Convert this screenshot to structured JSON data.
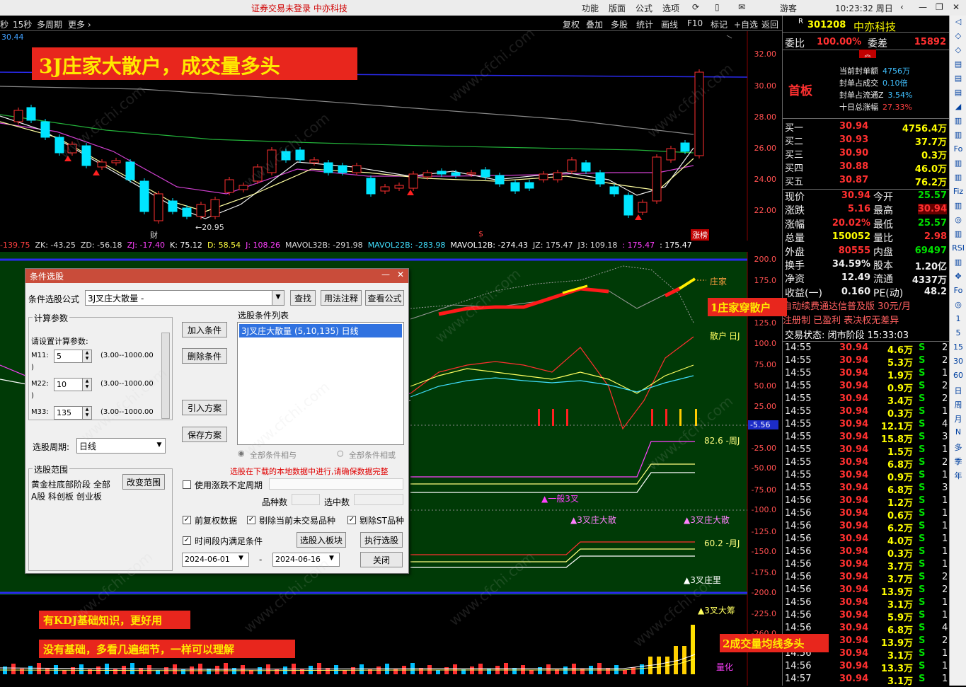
{
  "menubar": {
    "notice": "证券交易未登录 中亦科技",
    "items": [
      "功能",
      "版面",
      "公式",
      "选项"
    ],
    "guest": "游客",
    "clock": "10:23:32 周日"
  },
  "toolbar": {
    "left": [
      "秒",
      "15秒",
      "多周期",
      "更多 ›"
    ],
    "right": [
      "复权",
      "叠加",
      "多股",
      "统计",
      "画线",
      "F10",
      "标记",
      "+自选",
      "返回"
    ]
  },
  "chart": {
    "top_label": "30.44",
    "price_axis": [
      "32.00",
      "30.00",
      "28.00",
      "26.00",
      "24.00",
      "22.00"
    ],
    "low_label": "←20.95",
    "marks": [
      "财",
      "$",
      "涨榜"
    ],
    "banner_main": "3J庄家大散户，成交量多头",
    "mid_axis": [
      "200.0",
      "175.0",
      "125.0",
      "100.0",
      "75.00",
      "50.00",
      "25.00",
      "-5.56",
      "-25.00",
      "-50.00",
      "-75.00",
      "-100.0",
      "-125.0",
      "-150.0",
      "-175.0",
      "-200.0",
      "-225.0",
      "-260.0"
    ],
    "mid_labels": {
      "zhuangjia": "庄家",
      "sanhu": "散户",
      "rikdj": "日J",
      "zhoukdj": "82.6 -周J",
      "yuekdj": "60.2 -月J",
      "yiban": "▲一般3叉",
      "zhuangda1": "▲3叉庄大散",
      "zhuangda2": "▲3叉庄大散",
      "zhuangli": "▲3叉庄里",
      "dachou": "▲3叉大筹",
      "lianghua": "量化"
    },
    "callout1": "1庄家穿散户",
    "callout2": "2成交量均线多头",
    "note1": "有KDJ基础知识，更好用",
    "note2": "没有基础，多看几遍细节，一样可以理解",
    "watermark": "www.cfchi.com"
  },
  "indicators": [
    {
      "text": "-139.75",
      "color": "#ff4040"
    },
    {
      "text": "ZK: -43.25",
      "color": "#dddddd"
    },
    {
      "text": "ZD: -56.18",
      "color": "#dddddd"
    },
    {
      "text": "ZJ: -17.40",
      "color": "#ff40ff"
    },
    {
      "text": "K: 75.12",
      "color": "#ffffff"
    },
    {
      "text": "D: 58.54",
      "color": "#ffff40"
    },
    {
      "text": "J: 108.26",
      "color": "#ff40ff"
    },
    {
      "text": "MAVOL32B: -291.98",
      "color": "#dddddd"
    },
    {
      "text": "MAVOL22B: -283.98",
      "color": "#40e0ff"
    },
    {
      "text": "MAVOL12B: -274.43",
      "color": "#ffffff"
    },
    {
      "text": "JZ: 175.47",
      "color": "#dddddd"
    },
    {
      "text": "J3: 109.18",
      "color": "#dddddd"
    },
    {
      "text": ": 175.47",
      "color": "#ff40ff"
    },
    {
      "text": ": 175.47",
      "color": "#ffffff"
    }
  ],
  "quote": {
    "code": "301208",
    "name": "中亦科技",
    "weibi_label": "委比",
    "weibi": "100.00%",
    "weicha_label": "委差",
    "weicha": "15892",
    "board": "首板",
    "seal": [
      {
        "label": "当前封单额",
        "value": "4756万"
      },
      {
        "label": "封单占成交",
        "value": "0.10倍"
      },
      {
        "label": "封单占流通Z",
        "value": "3.54%"
      },
      {
        "label": "十日总涨幅",
        "value": "27.33%"
      }
    ],
    "bids": [
      {
        "label": "买一",
        "price": "30.94",
        "vol": "4756.4万"
      },
      {
        "label": "买二",
        "price": "30.93",
        "vol": "37.7万"
      },
      {
        "label": "买三",
        "price": "30.90",
        "vol": "0.3万"
      },
      {
        "label": "买四",
        "price": "30.88",
        "vol": "46.0万"
      },
      {
        "label": "买五",
        "price": "30.87",
        "vol": "76.2万"
      }
    ],
    "stats": [
      {
        "l1": "现价",
        "v1": "30.94",
        "c1": "red",
        "l2": "今开",
        "v2": "25.57",
        "c2": "green"
      },
      {
        "l1": "涨跌",
        "v1": "5.16",
        "c1": "red",
        "l2": "最高",
        "v2": "30.94",
        "c2": "red"
      },
      {
        "l1": "涨幅",
        "v1": "20.02%",
        "c1": "red",
        "l2": "最低",
        "v2": "25.57",
        "c2": "green"
      },
      {
        "l1": "总量",
        "v1": "150052",
        "c1": "yellow",
        "l2": "量比",
        "v2": "2.98",
        "c2": "red"
      },
      {
        "l1": "外盘",
        "v1": "80555",
        "c1": "red",
        "l2": "内盘",
        "v2": "69497",
        "c2": "green"
      },
      {
        "l1": "换手",
        "v1": "34.59%",
        "c1": "white",
        "l2": "股本",
        "v2": "1.20亿",
        "c2": "white"
      },
      {
        "l1": "净资",
        "v1": "12.49",
        "c1": "white",
        "l2": "流通",
        "v2": "4337万",
        "c2": "white"
      },
      {
        "l1": "收益(一)",
        "v1": "0.160",
        "c1": "white",
        "l2": "PE(动)",
        "v2": "48.2",
        "c2": "white"
      }
    ],
    "info1": "自动续费通达信普及版 30元/月",
    "info2": "注册制 已盈利 表决权无差异",
    "status": "交易状态: 闭市阶段 15:33:03",
    "ticks": [
      {
        "t": "14:55",
        "p": "30.94",
        "v": "4.6万",
        "s": "S",
        "n": "2"
      },
      {
        "t": "14:55",
        "p": "30.94",
        "v": "5.3万",
        "s": "S",
        "n": "2"
      },
      {
        "t": "14:55",
        "p": "30.94",
        "v": "1.9万",
        "s": "S",
        "n": "1"
      },
      {
        "t": "14:55",
        "p": "30.94",
        "v": "0.9万",
        "s": "S",
        "n": "2"
      },
      {
        "t": "14:55",
        "p": "30.94",
        "v": "3.4万",
        "s": "S",
        "n": "2"
      },
      {
        "t": "14:55",
        "p": "30.94",
        "v": "0.3万",
        "s": "S",
        "n": "1"
      },
      {
        "t": "14:55",
        "p": "30.94",
        "v": "12.1万",
        "s": "S",
        "n": "4"
      },
      {
        "t": "14:55",
        "p": "30.94",
        "v": "15.8万",
        "s": "S",
        "n": "3"
      },
      {
        "t": "14:55",
        "p": "30.94",
        "v": "1.5万",
        "s": "S",
        "n": "1"
      },
      {
        "t": "14:55",
        "p": "30.94",
        "v": "6.8万",
        "s": "S",
        "n": "2"
      },
      {
        "t": "14:55",
        "p": "30.94",
        "v": "0.9万",
        "s": "S",
        "n": "1"
      },
      {
        "t": "14:55",
        "p": "30.94",
        "v": "6.8万",
        "s": "S",
        "n": "3"
      },
      {
        "t": "14:56",
        "p": "30.94",
        "v": "1.2万",
        "s": "S",
        "n": "1"
      },
      {
        "t": "14:56",
        "p": "30.94",
        "v": "0.6万",
        "s": "S",
        "n": "1"
      },
      {
        "t": "14:56",
        "p": "30.94",
        "v": "6.2万",
        "s": "S",
        "n": "1"
      },
      {
        "t": "14:56",
        "p": "30.94",
        "v": "4.0万",
        "s": "S",
        "n": "1"
      },
      {
        "t": "14:56",
        "p": "30.94",
        "v": "0.3万",
        "s": "S",
        "n": "1"
      },
      {
        "t": "14:56",
        "p": "30.94",
        "v": "3.7万",
        "s": "S",
        "n": "1"
      },
      {
        "t": "14:56",
        "p": "30.94",
        "v": "3.7万",
        "s": "S",
        "n": "2"
      },
      {
        "t": "14:56",
        "p": "30.94",
        "v": "13.9万",
        "s": "S",
        "n": "2"
      },
      {
        "t": "14:56",
        "p": "30.94",
        "v": "3.1万",
        "s": "S",
        "n": "1"
      },
      {
        "t": "14:56",
        "p": "30.94",
        "v": "5.9万",
        "s": "S",
        "n": "1"
      },
      {
        "t": "14:56",
        "p": "30.94",
        "v": "6.8万",
        "s": "S",
        "n": "4"
      },
      {
        "t": "14:56",
        "p": "30.94",
        "v": "13.9万",
        "s": "S",
        "n": "2"
      },
      {
        "t": "14:56",
        "p": "30.94",
        "v": "3.1万",
        "s": "S",
        "n": "1"
      },
      {
        "t": "14:56",
        "p": "30.94",
        "v": "13.3万",
        "s": "S",
        "n": "1"
      },
      {
        "t": "14:57",
        "p": "30.94",
        "v": "3.1万",
        "s": "S",
        "n": "1"
      }
    ]
  },
  "sidebar": [
    "◁",
    "◇",
    "◇",
    "▤",
    "▤",
    "▤",
    "◢",
    "▥",
    "▥",
    "Fo",
    "▥",
    "▥",
    "Fiz",
    "▥",
    "◎",
    "▥",
    "RSI",
    "▥",
    "✥",
    "Fo",
    "◎",
    "1",
    "5",
    "15",
    "30",
    "60",
    "日",
    "周",
    "月",
    "N",
    "多",
    "季",
    "年"
  ],
  "dialog": {
    "title": "条件选股",
    "formula_label": "条件选股公式",
    "formula_value": "3J叉庄大散量 -",
    "find_btn": "查找",
    "usage_btn": "用法注释",
    "view_btn": "查看公式",
    "params_group": "计算参数",
    "params_prompt": "请设置计算参数:",
    "params": [
      {
        "name": "M11:",
        "value": "5",
        "range": "(3.00--1000.00"
      },
      {
        "name": "M22:",
        "value": "10",
        "range": "(3.00--1000.00"
      },
      {
        "name": "M33:",
        "value": "135",
        "range": "(3.00--1000.00"
      }
    ],
    "paren": ")",
    "period_label": "选股周期:",
    "period_value": "日线",
    "add_btn": "加入条件",
    "del_btn": "删除条件",
    "import_btn": "引入方案",
    "save_btn": "保存方案",
    "list_label": "选股条件列表",
    "list_item": "3J叉庄大散量 (5,10,135) 日线",
    "radio_and": "全部条件相与",
    "radio_or": "全部条件相或",
    "scope_group": "选股范围",
    "scope_line1": "黄金柱底部阶段 全部",
    "scope_line2": "A股 科创板 创业板",
    "scope_btn": "改变范围",
    "warning": "选股在下载的本地数据中进行,请确保数据完整",
    "use_period": "使用涨跌不定周期",
    "count_label": "品种数",
    "selected_label": "选中数",
    "fq": "前复权数据",
    "excl_notrade": "剔除当前未交易品种",
    "excl_st": "剔除ST品种",
    "time_range": "时间段内满足条件",
    "to_block_btn": "选股入板块",
    "exec_btn": "执行选股",
    "close_btn": "关闭",
    "date_from": "2024-06-01",
    "date_to": "2024-06-16",
    "dash": "-"
  },
  "colors": {
    "up": "#ff3030",
    "down": "#00e5ff",
    "accent": "#e8261d"
  }
}
